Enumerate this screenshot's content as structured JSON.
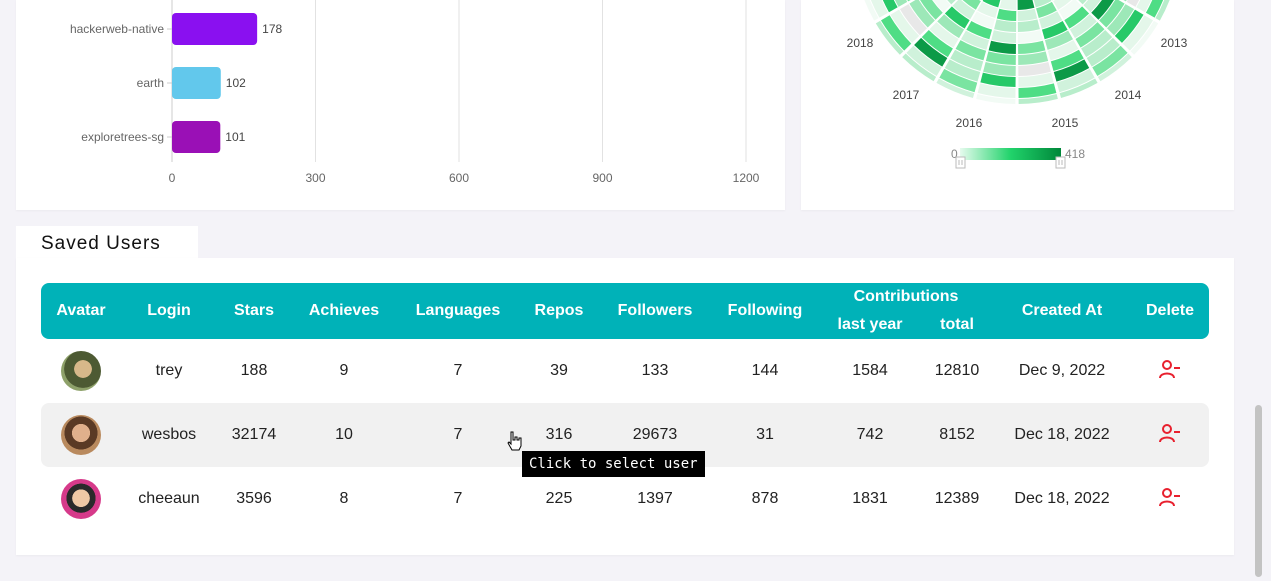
{
  "bar_chart": {
    "chart_data": {
      "type": "bar",
      "orientation": "horizontal",
      "categories": [
        "hackerweb-native",
        "earth",
        "exploretrees-sg"
      ],
      "values": [
        178,
        102,
        101
      ],
      "colors": [
        "#8a10f0",
        "#62c8ec",
        "#9a10b6"
      ],
      "xlim": [
        0,
        1200
      ],
      "xticks": [
        "0",
        "300",
        "600",
        "900",
        "1200"
      ],
      "grid": true
    }
  },
  "radial_chart": {
    "labels": [
      "2018",
      "2013",
      "2017",
      "2014",
      "2016",
      "2015"
    ],
    "legend_min": "0",
    "legend_max": "418",
    "color_low": "#e6fbee",
    "color_high": "#00873a"
  },
  "saved_users": {
    "tab_label": "Saved Users",
    "headers": {
      "avatar": "Avatar",
      "login": "Login",
      "stars": "Stars",
      "achieves": "Achieves",
      "languages": "Languages",
      "repos": "Repos",
      "followers": "Followers",
      "following": "Following",
      "contributions": "Contributions",
      "last_year": "last year",
      "total": "total",
      "created_at": "Created At",
      "delete": "Delete"
    },
    "rows": [
      {
        "login": "trey",
        "stars": "188",
        "achieves": "9",
        "languages": "7",
        "repos": "39",
        "followers": "133",
        "following": "144",
        "last_year": "1584",
        "total": "12810",
        "created_at": "Dec 9, 2022"
      },
      {
        "login": "wesbos",
        "stars": "32174",
        "achieves": "10",
        "languages": "7",
        "repos": "316",
        "followers": "29673",
        "following": "31",
        "last_year": "742",
        "total": "8152",
        "created_at": "Dec 18, 2022"
      },
      {
        "login": "cheeaun",
        "stars": "3596",
        "achieves": "8",
        "languages": "7",
        "repos": "225",
        "followers": "1397",
        "following": "878",
        "last_year": "1831",
        "total": "12389",
        "created_at": "Dec 18, 2022"
      }
    ],
    "delete_icon": "user-minus-icon",
    "delete_color": "#e8202e",
    "header_color": "#00b2b8"
  },
  "tooltip": {
    "text": "Click to select user"
  }
}
